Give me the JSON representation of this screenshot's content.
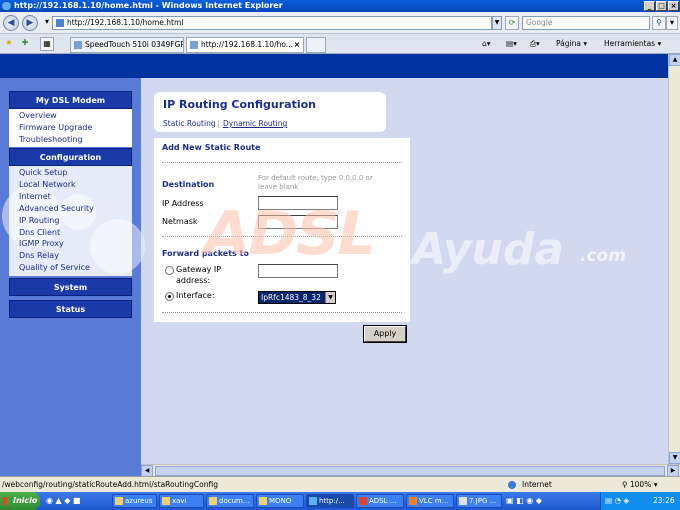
{
  "window": {
    "title": "http://192.168.1.10/home.html - Windows Internet Explorer"
  },
  "address_bar": {
    "url": "http://192.168.1.10/home.html",
    "search_placeholder": "Google"
  },
  "tabs": [
    {
      "label": "SpeedTouch 510i  0349FGP3G"
    },
    {
      "label": "http://192.168.1.10/ho..."
    }
  ],
  "toolbar": {
    "page_label": "Página",
    "tools_label": "Herramientas"
  },
  "sidebar": {
    "sections": [
      {
        "title": "My DSL Modem",
        "items": [
          "Overview",
          "Firmware Upgrade",
          "Troubleshooting"
        ]
      },
      {
        "title": "Configuration",
        "items": [
          "Quick Setup",
          "Local Network",
          "Internet",
          "Advanced Security",
          "IP Routing",
          "Dns Client",
          "IGMP Proxy",
          "Dns Relay",
          "Quality of Service"
        ]
      },
      {
        "title": "System",
        "items": []
      },
      {
        "title": "Status",
        "items": []
      }
    ]
  },
  "panel": {
    "title": "IP Routing Configuration",
    "links": [
      "Static Routing",
      "Dynamic Routing"
    ]
  },
  "form": {
    "section_title": "Add New Static Route",
    "destination_label": "Destination",
    "destination_hint": "For default route, type 0.0.0.0 or leave blank",
    "ip_address_label": "IP Address",
    "ip_address_value": "",
    "netmask_label": "Netmask",
    "netmask_value": "",
    "forward_label": "Forward packets to",
    "gateway_label": "Gateway IP address:",
    "gateway_value": "",
    "interface_label": "Interface:",
    "interface_value": "IpRfc1483_8_32",
    "apply_label": "Apply"
  },
  "watermark": {
    "part1": "ADSL",
    "part2": "Ayuda",
    "part3": ".com"
  },
  "statusbar": {
    "url": "/webconfig/routing/staticRouteAdd.html/staRoutingConfig",
    "zone": "Internet",
    "zoom": "100%"
  },
  "taskbar": {
    "start_label": "Inicio",
    "tasks": [
      "azureus",
      "xavi",
      "docum...",
      "MONO",
      "http:/...",
      "ADSL ...",
      "VLC m...",
      "7.JPG ..."
    ],
    "clock": "23:26"
  }
}
